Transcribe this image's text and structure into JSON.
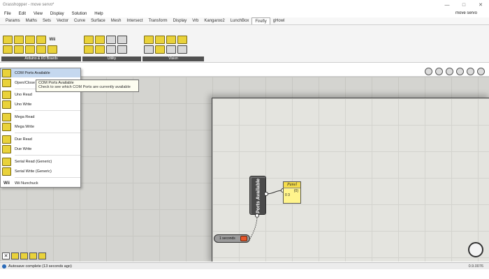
{
  "window": {
    "title": "Grasshopper - move servo*",
    "document_name": "move servo"
  },
  "menu": [
    "File",
    "Edit",
    "View",
    "Display",
    "Solution",
    "Help"
  ],
  "tabs": [
    "Params",
    "Maths",
    "Sets",
    "Vector",
    "Curve",
    "Surface",
    "Mesh",
    "Intersect",
    "Transform",
    "Display",
    "Vrb",
    "Kangaroo2",
    "LunchBox",
    "Firefly",
    "gHowl"
  ],
  "active_tab": "Firefly",
  "ribbon": {
    "groups": [
      "Arduino & I/O Boards",
      "Utility",
      "Vision"
    ],
    "icon_labels": {
      "wii": "Wii"
    }
  },
  "dropdown": {
    "items": [
      {
        "label": "COM Ports Available",
        "icon": "ports-icon"
      },
      {
        "label": "Open/Close",
        "icon": "open-icon"
      },
      {
        "label": "Uno Read",
        "icon": "uno-read-icon"
      },
      {
        "label": "Uno Write",
        "icon": "uno-write-icon"
      },
      {
        "label": "Mega Read",
        "icon": "mega-read-icon"
      },
      {
        "label": "Mega Write",
        "icon": "mega-write-icon"
      },
      {
        "label": "Due Read",
        "icon": "due-read-icon"
      },
      {
        "label": "Due Write",
        "icon": "due-write-icon"
      },
      {
        "label": "Serial Read (Generic)",
        "icon": "serial-read-icon"
      },
      {
        "label": "Serial Write (Generic)",
        "icon": "serial-write-icon"
      },
      {
        "label": "Wii Nunchuck",
        "icon": "wii-icon"
      }
    ],
    "wii_icon_text": "Wii"
  },
  "tooltip": {
    "title": "COM Ports Available",
    "description": "Check to see which COM Ports are currently available"
  },
  "canvas": {
    "component_label": "Ports Available",
    "panel_title": "Panel",
    "panel_index": "{0}",
    "panel_value": "0  3",
    "timer_label": "1 seconds"
  },
  "status": {
    "text": "Autosave complete (13 seconds ago)",
    "version": "0.9.0076"
  }
}
